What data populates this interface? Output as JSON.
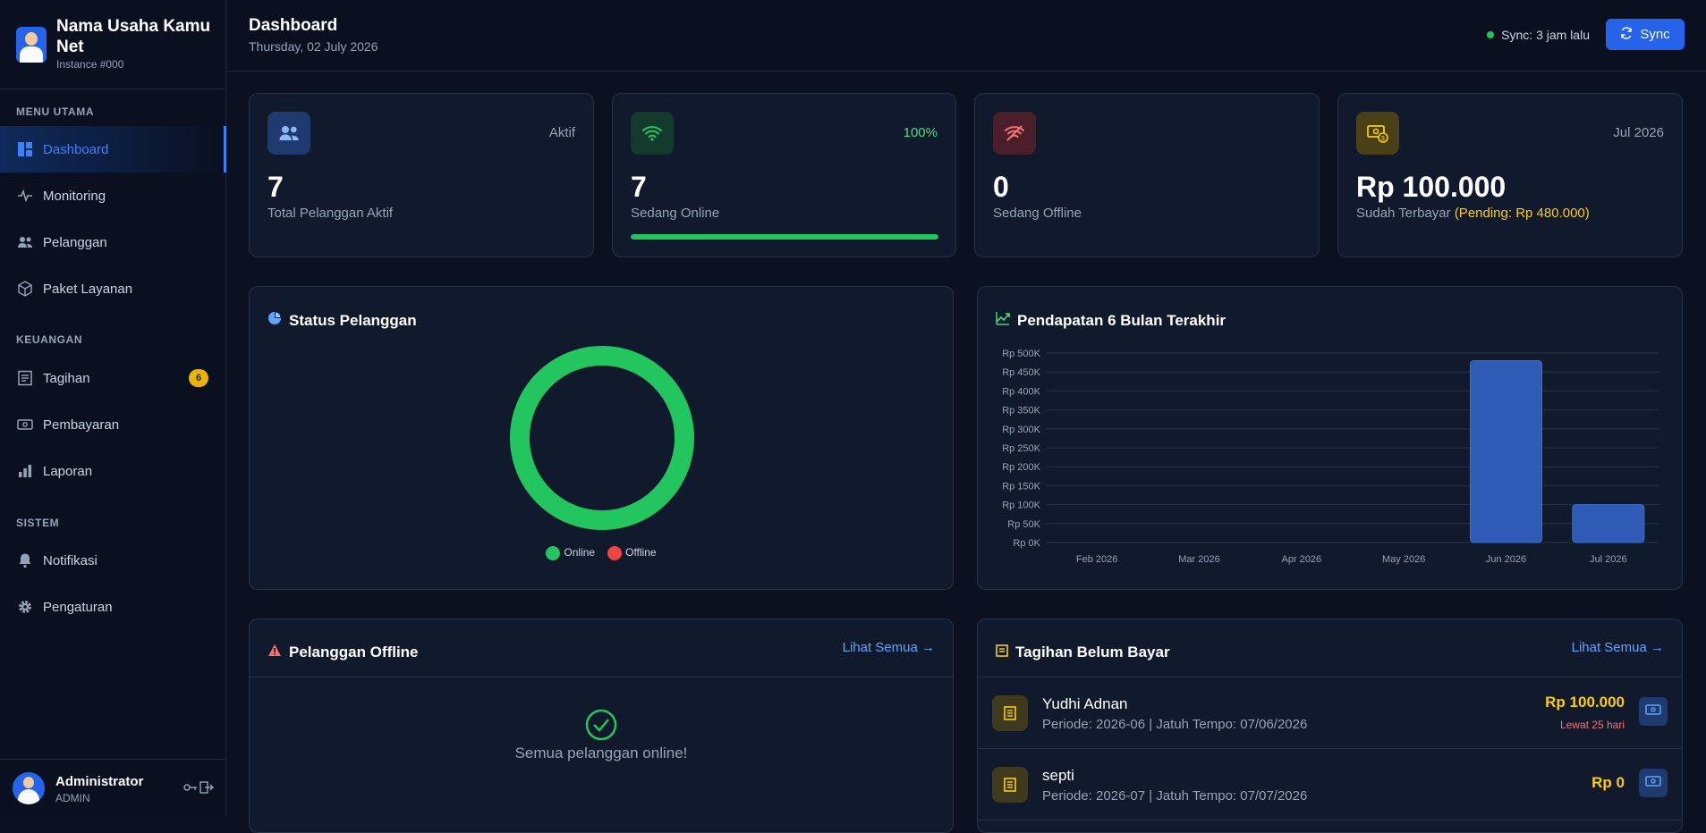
{
  "brand": {
    "name": "Nama Usaha Kamu Net",
    "instance": "Instance #000"
  },
  "nav": {
    "section_main": "MENU UTAMA",
    "section_finance": "KEUANGAN",
    "section_system": "SISTEM",
    "items": [
      {
        "label": "Dashboard",
        "icon": "dashboard-icon",
        "active": true
      },
      {
        "label": "Monitoring",
        "icon": "pulse-icon"
      },
      {
        "label": "Pelanggan",
        "icon": "users-icon"
      },
      {
        "label": "Paket Layanan",
        "icon": "package-icon"
      },
      {
        "label": "Tagihan",
        "icon": "invoice-icon",
        "badge": "6"
      },
      {
        "label": "Pembayaran",
        "icon": "cash-icon"
      },
      {
        "label": "Laporan",
        "icon": "bar-chart-icon"
      },
      {
        "label": "Notifikasi",
        "icon": "bell-icon"
      },
      {
        "label": "Pengaturan",
        "icon": "gear-icon"
      }
    ]
  },
  "user": {
    "name": "Administrator",
    "role": "ADMIN"
  },
  "header": {
    "title": "Dashboard",
    "date": "Thursday, 02 July 2026",
    "sync_status": "Sync: 3 jam lalu",
    "sync_button": "Sync"
  },
  "stats": {
    "active": {
      "tag": "Aktif",
      "value": "7",
      "label": "Total Pelanggan Aktif"
    },
    "online": {
      "tag": "100%",
      "value": "7",
      "label": "Sedang Online",
      "progress": 1.0
    },
    "offline": {
      "value": "0",
      "label": "Sedang Offline"
    },
    "paid": {
      "tag": "Jul 2026",
      "value": "Rp 100.000",
      "label": "Sudah Terbayar",
      "pending": "(Pending: Rp 480.000)"
    }
  },
  "status_panel": {
    "title": "Status Pelanggan",
    "legend_online": "Online",
    "legend_offline": "Offline"
  },
  "revenue_panel": {
    "title": "Pendapatan 6 Bulan Terakhir"
  },
  "chart_data": [
    {
      "type": "pie",
      "categories": [
        "Online",
        "Offline"
      ],
      "values": [
        7,
        0
      ],
      "colors": [
        "#22c55e",
        "#ef4444"
      ],
      "legend": "bottom"
    },
    {
      "type": "bar",
      "categories": [
        "Feb 2026",
        "Mar 2026",
        "Apr 2026",
        "May 2026",
        "Jun 2026",
        "Jul 2026"
      ],
      "values": [
        0,
        0,
        0,
        0,
        480000,
        100000
      ],
      "ylim": [
        0,
        500000
      ],
      "yticks": [
        "Rp 0K",
        "Rp 50K",
        "Rp 100K",
        "Rp 150K",
        "Rp 200K",
        "Rp 250K",
        "Rp 300K",
        "Rp 350K",
        "Rp 400K",
        "Rp 450K",
        "Rp 500K"
      ],
      "grid": true,
      "color": "#2d5bb5"
    }
  ],
  "offline_panel": {
    "title": "Pelanggan Offline",
    "link": "Lihat Semua →",
    "empty": "Semua pelanggan online!"
  },
  "bills_panel": {
    "title": "Tagihan Belum Bayar",
    "link": "Lihat Semua →",
    "rows": [
      {
        "name": "Yudhi Adnan",
        "detail": "Periode: 2026-06 | Jatuh Tempo: 07/06/2026",
        "amount": "Rp 100.000",
        "late": "Lewat 25 hari"
      },
      {
        "name": "septi",
        "detail": "Periode: 2026-07 | Jatuh Tempo: 07/07/2026",
        "amount": "Rp 0",
        "late": ""
      }
    ]
  }
}
